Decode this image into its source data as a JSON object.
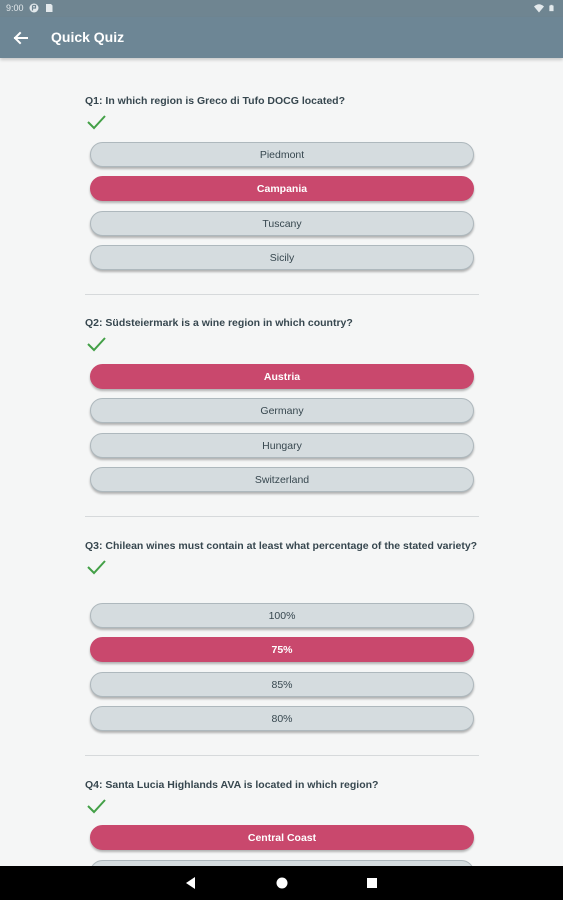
{
  "status_bar": {
    "time": "9:00",
    "left_icons": [
      "notification-icon",
      "sd-card-icon"
    ],
    "right_icons": [
      "wifi-icon",
      "battery-icon"
    ]
  },
  "app_bar": {
    "back_icon": "arrow-back-icon",
    "title": "Quick Quiz"
  },
  "colors": {
    "app_bar": "#6d8695",
    "selected_answer": "#c9486d",
    "option": "#d5dcdf",
    "check": "#43a047"
  },
  "questions": [
    {
      "text": "Q1: In which region is Greco di Tufo DOCG located?",
      "answered_correct": true,
      "options": [
        "Piedmont",
        "Campania",
        "Tuscany",
        "Sicily"
      ],
      "selected_index": 1
    },
    {
      "text": "Q2: Südsteiermark is a wine region in which country?",
      "answered_correct": true,
      "options": [
        "Austria",
        "Germany",
        "Hungary",
        "Switzerland"
      ],
      "selected_index": 0
    },
    {
      "text": "Q3: Chilean wines must contain at least what percentage of the stated variety?",
      "answered_correct": true,
      "options": [
        "100%",
        "75%",
        "85%",
        "80%"
      ],
      "selected_index": 1
    },
    {
      "text": "Q4: Santa Lucia Highlands AVA is located in which region?",
      "answered_correct": true,
      "options": [
        "Central Coast",
        ""
      ],
      "selected_index": 0
    }
  ],
  "nav_bar": {
    "buttons": [
      "back-triangle-icon",
      "home-circle-icon",
      "recents-square-icon"
    ]
  }
}
